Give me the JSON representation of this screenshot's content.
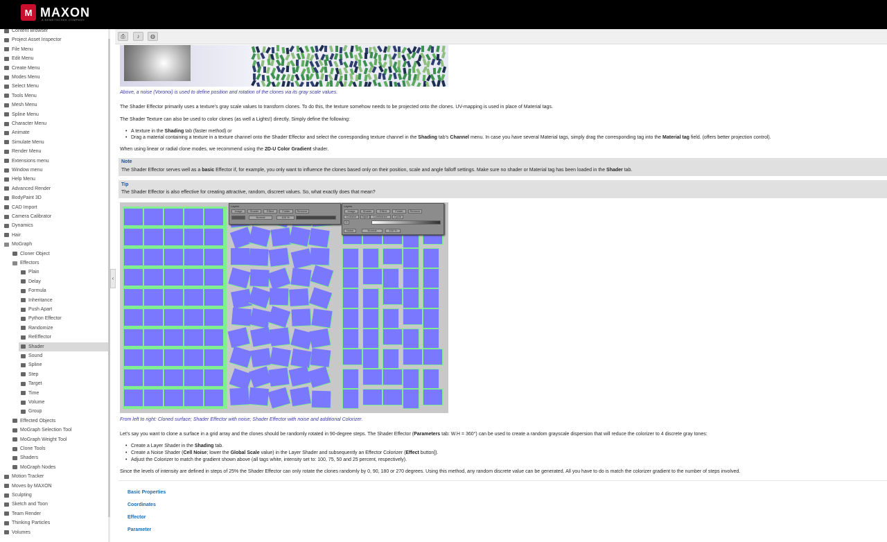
{
  "header": {
    "brand": "MAXON",
    "tagline": "A NEMETSCHEK COMPANY",
    "logo_letter": "M"
  },
  "sidebar": {
    "items": [
      {
        "label": "Content Browser",
        "level": 0,
        "y": 0
      },
      {
        "label": "Project Asset Inspector",
        "level": 0
      },
      {
        "label": "File Menu",
        "level": 0
      },
      {
        "label": "Edit Menu",
        "level": 0
      },
      {
        "label": "Create Menu",
        "level": 0
      },
      {
        "label": "Modes Menu",
        "level": 0
      },
      {
        "label": "Select Menu",
        "level": 0
      },
      {
        "label": "Tools Menu",
        "level": 0
      },
      {
        "label": "Mesh Menu",
        "level": 0
      },
      {
        "label": "Spline Menu",
        "level": 0
      },
      {
        "label": "Character Menu",
        "level": 0
      },
      {
        "label": "Animate",
        "level": 0
      },
      {
        "label": "Simulate Menu",
        "level": 0
      },
      {
        "label": "Render Menu",
        "level": 0
      },
      {
        "label": "Extensions menu",
        "level": 0
      },
      {
        "label": "Window menu",
        "level": 0
      },
      {
        "label": "Help Menu",
        "level": 0
      },
      {
        "label": "Advanced Render",
        "level": 0
      },
      {
        "label": "BodyPaint 3D",
        "level": 0
      },
      {
        "label": "CAD Import",
        "level": 0
      },
      {
        "label": "Camera Calibrator",
        "level": 0
      },
      {
        "label": "Dynamics",
        "level": 0
      },
      {
        "label": "Hair",
        "level": 0
      },
      {
        "label": "MoGraph",
        "level": 0,
        "open": true
      },
      {
        "label": "Cloner Object",
        "level": 1
      },
      {
        "label": "Effectors",
        "level": 1,
        "open": true
      },
      {
        "label": "Plain",
        "level": 2
      },
      {
        "label": "Delay",
        "level": 2
      },
      {
        "label": "Formula",
        "level": 2
      },
      {
        "label": "Inheritance",
        "level": 2
      },
      {
        "label": "Push Apart",
        "level": 2
      },
      {
        "label": "Python Effector",
        "level": 2
      },
      {
        "label": "Randomize",
        "level": 2
      },
      {
        "label": "ReEffector",
        "level": 2
      },
      {
        "label": "Shader",
        "level": 2,
        "active": true
      },
      {
        "label": "Sound",
        "level": 2
      },
      {
        "label": "Spline",
        "level": 2
      },
      {
        "label": "Step",
        "level": 2
      },
      {
        "label": "Target",
        "level": 2
      },
      {
        "label": "Time",
        "level": 2
      },
      {
        "label": "Volume",
        "level": 2
      },
      {
        "label": "Group",
        "level": 2
      },
      {
        "label": "Effected Objects",
        "level": 1
      },
      {
        "label": "MoGraph Selection Tool",
        "level": 1
      },
      {
        "label": "MoGraph Weight Tool",
        "level": 1
      },
      {
        "label": "Clone Tools",
        "level": 1
      },
      {
        "label": "Shaders",
        "level": 1
      },
      {
        "label": "MoGraph Nodes",
        "level": 1
      },
      {
        "label": "Motion Tracker",
        "level": 0
      },
      {
        "label": "Moves by MAXON",
        "level": 0
      },
      {
        "label": "Sculpting",
        "level": 0
      },
      {
        "label": "Sketch and Toon",
        "level": 0
      },
      {
        "label": "Team Render",
        "level": 0
      },
      {
        "label": "Thinking Particles",
        "level": 0
      },
      {
        "label": "Volumes",
        "level": 0
      }
    ]
  },
  "toolbar": {
    "print_icon": "printer-icon",
    "audio_icon": "speaker-icon",
    "web_icon": "globe-icon"
  },
  "content": {
    "caption1": "Above, a noise (Voronoi) is used to define position and rotation of the clones via its gray scale values.",
    "para1": "The Shader Effector primarily uses a texture's gray scale values to transform clones. To do this, the texture somehow needs to be projected onto the clones. UV-mapping is used in place of Material tags.",
    "para2": "The Shader Texture can also be used to color clones (as well a Lights!) directly. Simply define the following:",
    "list1": [
      {
        "pre": "A texture in the ",
        "b1": "Shading",
        "post": " tab (faster method) or"
      },
      {
        "pre": "Drag a material containing a texture in a texture channel onto the Shader Effector and select the corresponding texture channel in the ",
        "b1": "Shading",
        "mid": " tab's ",
        "b2": "Channel",
        "mid2": " menu. In case you have several Material tags, simply drag the corresponding tag into the ",
        "b3": "Material tag",
        "post": " field. (offers better projection control)."
      }
    ],
    "para3_pre": "When using linear or radial clone modes, we recommend using the ",
    "para3_b": "2D-U Color Gradient",
    "para3_post": " shader.",
    "note_title": "Note",
    "note_pre": "The Shader Effector serves well as a ",
    "note_b": "basic",
    "note_mid": " Effector if, for example, you only want to influence the clones based only on their position, scale and angle falloff settings. Make sure no shader or Material tag has been loaded in the ",
    "note_b2": "Shader",
    "note_post": " tab.",
    "tip_title": "Tip",
    "tip_text": "The Shader Effector is also effective for creating attractive, random, discreet values. So, what exactly does that mean?",
    "caption2": "From left to right: Cloned surface; Shader Effector with noise; Shader Effector with noise and additional Colorizer.",
    "para4_pre": "Let's say you want to clone a surface in a grid array and the clones should be randomly rotated in 90-degree steps. The Shader Effector (",
    "para4_b": "Parameters",
    "para4_post": " tab: W.H = 360°) can be used to create a random grayscale dispersion that will reduce the colorizer to 4 discrete gray tones:",
    "list2": [
      {
        "pre": "Create a Layer Shader in the ",
        "b1": "Shading",
        "post": " tab."
      },
      {
        "pre": "Create a Noise Shader (",
        "b1": "Cell Noise",
        "mid": "; lower the ",
        "b2": "Global Scale",
        "mid2": " value) in the Layer Shader and subsequently an Effector Colorizer (",
        "b3": "Effect",
        "post": " button])."
      },
      {
        "pre": "Adjust the Colorizer to match the gradient shown above (all tags white, intensity set to: 100, 75, 50 and 25 percent, respectively).",
        "b1": "",
        "post": ""
      }
    ],
    "para5": "Since the levels of intensity are defined in steps of 25% the Shader Effector can only rotate the clones randomly by 0, 90, 180 or 270 degrees. Using this method, any random discrete value can be generated. All you have to do is match the colorizer gradient to the number of steps involved.",
    "links": [
      "Basic Properties",
      "Coordinates",
      "Effector",
      "Parameter"
    ]
  },
  "figure": {
    "win1": {
      "title": "Layers",
      "buttons": [
        "Image",
        "Shader",
        "Effect",
        "Folder",
        "Remove"
      ],
      "mode": "Normal",
      "value": "100 %"
    },
    "win2": {
      "title": "Layers",
      "buttons": [
        "Image",
        "Shader",
        "Effect",
        "Folder",
        "Remove"
      ],
      "row1": "Colorize",
      "input_label": "Input",
      "input_value": "Luminance",
      "cycle": "Cycle",
      "g": "G",
      "row2": "Noise",
      "mode": "Normal",
      "value": "100 %"
    }
  },
  "colors": {
    "tile": "#7a78ff",
    "tile_gap": "#7fef8f",
    "accent_link": "#1b6ab0",
    "caption": "#3a3aa0"
  }
}
